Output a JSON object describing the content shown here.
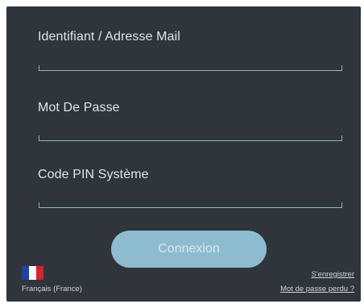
{
  "form": {
    "fields": [
      {
        "label": "Identifiant / Adresse Mail",
        "value": ""
      },
      {
        "label": "Mot De Passe",
        "value": ""
      },
      {
        "label": "Code PIN Système",
        "value": ""
      }
    ],
    "submit_label": "Connexion"
  },
  "footer": {
    "language_label": "Français (France)",
    "flag_icon": "france-flag-icon",
    "register_link": "S'enregistrer",
    "forgot_password_link": "Mot de passe perdu ?"
  },
  "colors": {
    "panel_background": "#2f353b",
    "field_underline": "#8fb3c6",
    "button_background": "#8dbcd0",
    "text": "#dfe4e8"
  }
}
